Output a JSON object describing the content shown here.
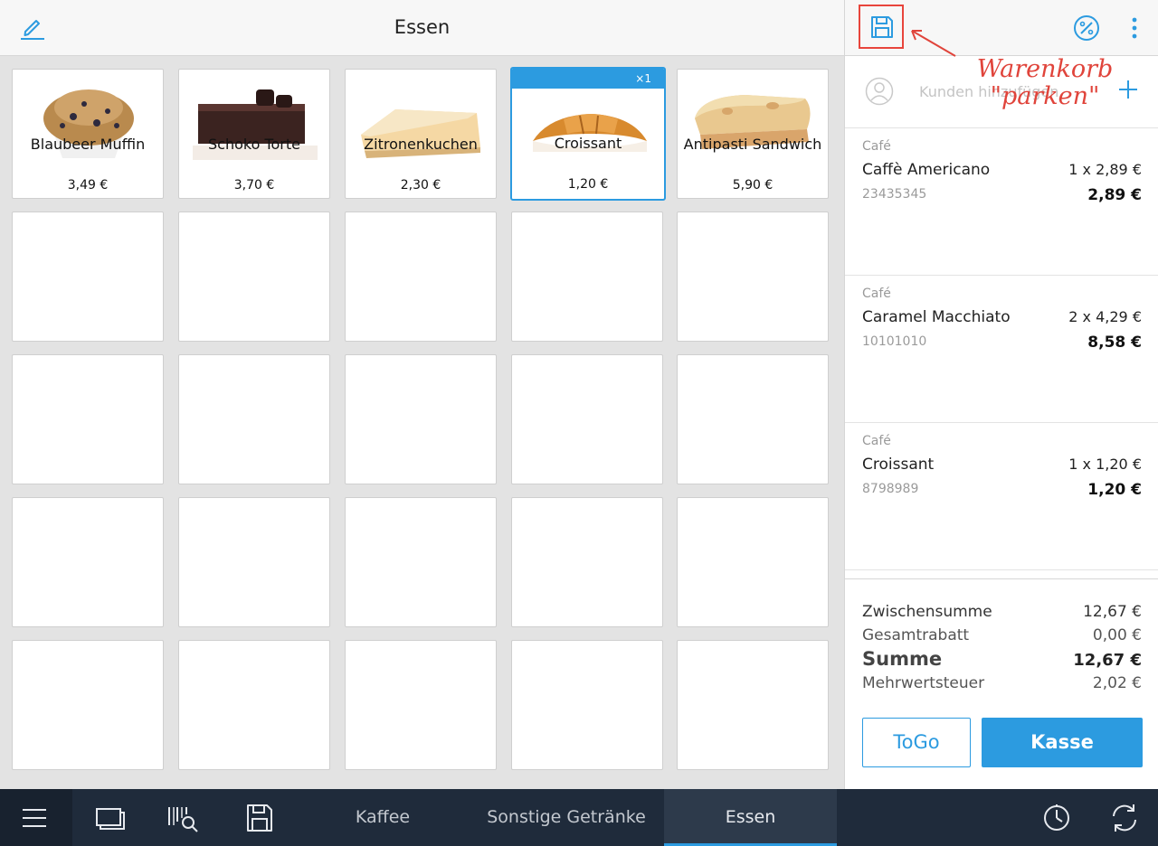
{
  "header": {
    "title": "Essen"
  },
  "products": [
    {
      "name": "Blaubeer Muffin",
      "price": "3,49 €",
      "image": "muffin"
    },
    {
      "name": "Schoko Torte",
      "price": "3,70 €",
      "image": "chocolate-cake"
    },
    {
      "name": "Zitronenkuchen",
      "price": "2,30 €",
      "image": "lemon-cake"
    },
    {
      "name": "Croissant",
      "price": "1,20 €",
      "image": "croissant",
      "selected": true,
      "qty_badge": "×1"
    },
    {
      "name": "Antipasti Sandwich",
      "price": "5,90 €",
      "image": "sandwich"
    }
  ],
  "annotation": {
    "line1": "Warenkorb",
    "line2": "\"parken\""
  },
  "customer": {
    "placeholder": "Kunden hinzufügen"
  },
  "cart": [
    {
      "category": "Café",
      "name": "Caffè Americano",
      "qty_price": "1 x 2,89 €",
      "sku": "23435345",
      "total": "2,89 €"
    },
    {
      "category": "Café",
      "name": "Caramel Macchiato",
      "qty_price": "2 x 4,29 €",
      "sku": "10101010",
      "total": "8,58 €"
    },
    {
      "category": "Café",
      "name": "Croissant",
      "qty_price": "1 x 1,20 €",
      "sku": "8798989",
      "total": "1,20 €"
    }
  ],
  "totals": {
    "subtotal_label": "Zwischensumme",
    "subtotal": "12,67 €",
    "discount_label": "Gesamtrabatt",
    "discount": "0,00 €",
    "sum_label": "Summe",
    "sum": "12,67 €",
    "tax_label": "Mehrwertsteuer",
    "tax": "2,02 €"
  },
  "buttons": {
    "togo": "ToGo",
    "kasse": "Kasse"
  },
  "bottom_tabs": [
    {
      "label": "Kaffee"
    },
    {
      "label": "Sonstige Getränke"
    },
    {
      "label": "Essen",
      "active": true
    }
  ],
  "colors": {
    "accent": "#2c9be0",
    "annotation": "#e0443b",
    "bottombar": "#1f2b3b"
  },
  "icons": [
    "edit-icon",
    "save-icon",
    "discount-icon",
    "more-icon",
    "customer-icon",
    "plus-icon",
    "menu-icon",
    "screens-icon",
    "barcode-search-icon",
    "clock-icon",
    "sync-icon"
  ]
}
